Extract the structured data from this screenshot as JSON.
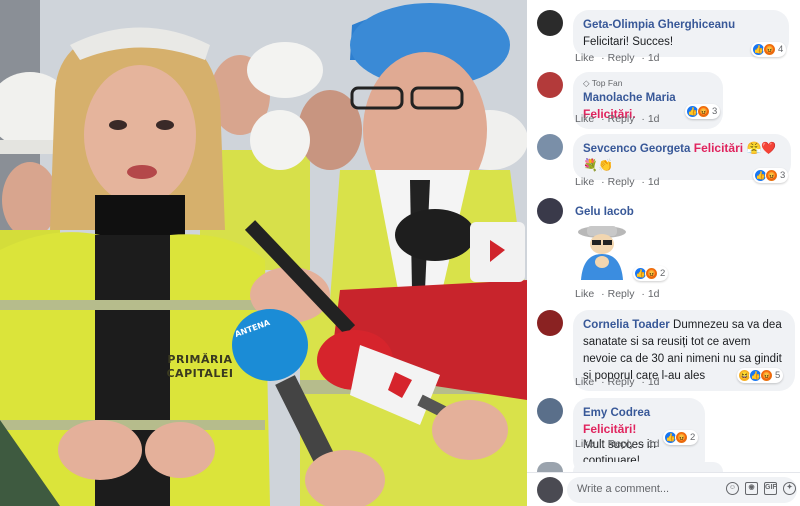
{
  "photo": {
    "vest_line1": "PRIMĂRIA",
    "vest_line2": "CAPITALEI",
    "mic_brand": "ANTENA"
  },
  "comments": [
    {
      "author": "Geta-Olimpia Gherghiceanu",
      "text": "Felicitari! Succes!",
      "like": "Like",
      "reply": "Reply",
      "time": "1d",
      "reactions": [
        "like",
        "angry"
      ],
      "count": "4"
    },
    {
      "badge": "Top Fan",
      "author": "Manolache Maria",
      "text": "Felicitări.",
      "like": "Like",
      "reply": "Reply",
      "time": "1d",
      "reactions": [
        "like",
        "angry"
      ],
      "count": "3"
    },
    {
      "author": "Sevcenco Georgeta",
      "text": "Felicitări",
      "emoji": "😤❤️💐👏",
      "like": "Like",
      "reply": "Reply",
      "time": "1d",
      "reactions": [
        "like",
        "angry"
      ],
      "count": "3"
    },
    {
      "author": "Gelu Iacob",
      "sticker": "sticker",
      "like": "Like",
      "reply": "Reply",
      "time": "1d",
      "reactions": [
        "like",
        "angry"
      ],
      "count": "2"
    },
    {
      "author": "Cornelia Toader",
      "text": "Dumnezeu sa va dea sanatate si sa reusiți tot ce avem nevoie ca de 30 ani nimeni nu sa gindit si poporul care l-au ales",
      "like": "Like",
      "reply": "Reply",
      "time": "1d",
      "reactions": [
        "haha",
        "like",
        "angry"
      ],
      "count": "5"
    },
    {
      "author": "Emy Codrea",
      "text": "Felicitări!",
      "text2": "Mult succes in continuare!",
      "like": "Like",
      "reply": "Reply",
      "time": "1d",
      "reactions": [
        "like",
        "angry"
      ],
      "count": "2"
    }
  ],
  "composer": {
    "placeholder": "Write a comment...",
    "icons": [
      "emoji-icon",
      "camera-icon",
      "gif-icon",
      "sticker-icon"
    ],
    "gif_label": "GIF"
  },
  "colors": {
    "link": "#385898",
    "highlight": "#e0245e",
    "like_blue": "#1877f2",
    "angry_orange": "#e9710f",
    "bubble": "#f0f2f5"
  }
}
